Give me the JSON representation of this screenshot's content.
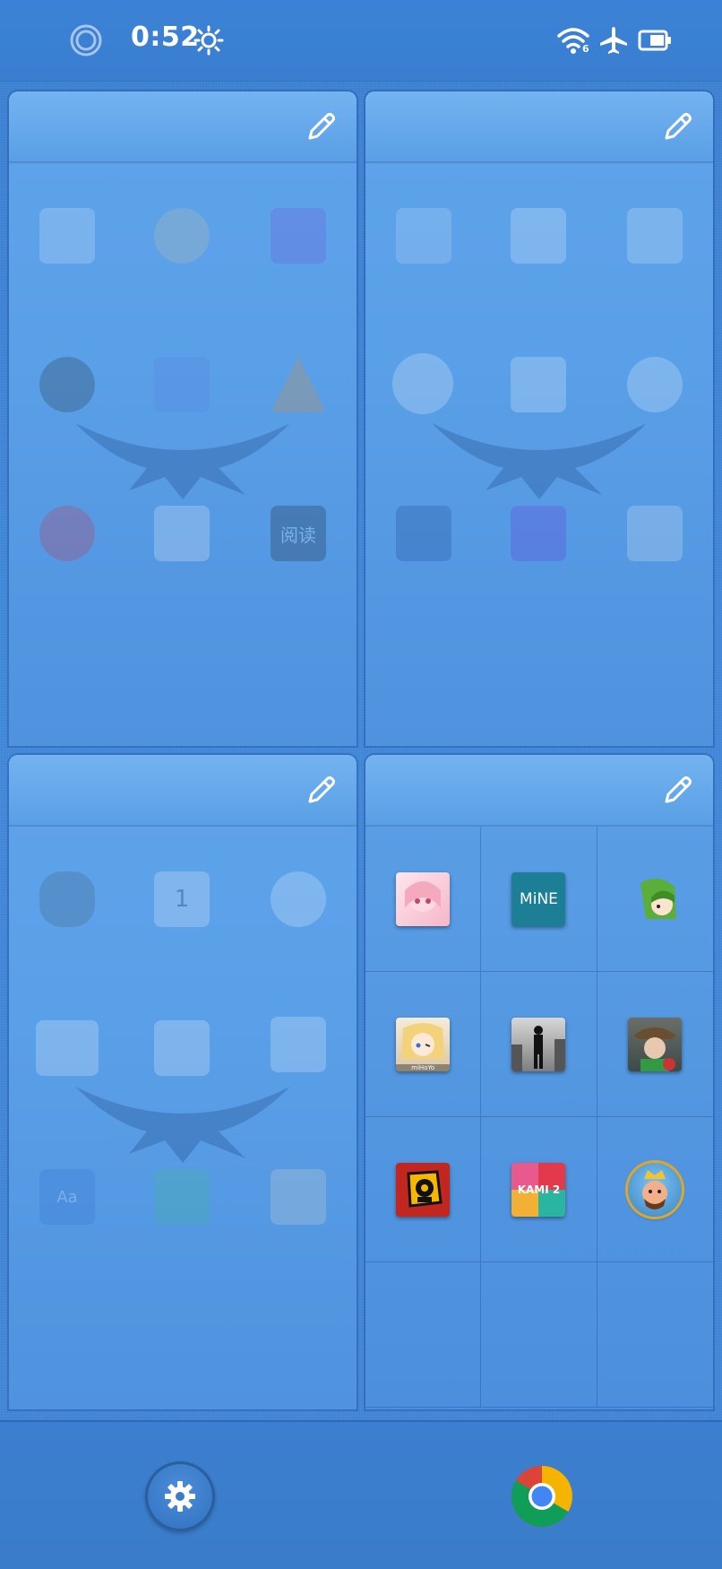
{
  "status_bar": {
    "time": "0:52",
    "wifi_badge": "6",
    "icons": [
      "record-circle-icon",
      "brightness-icon",
      "wifi-icon",
      "airplane-mode-icon",
      "battery-icon"
    ]
  },
  "panels": [
    {
      "name": "panel-1",
      "edit_icon": "pencil-icon"
    },
    {
      "name": "panel-2",
      "edit_icon": "pencil-icon"
    },
    {
      "name": "panel-3",
      "edit_icon": "pencil-icon"
    },
    {
      "name": "panel-4",
      "edit_icon": "pencil-icon"
    }
  ],
  "ghost_labels": {
    "calendar_day": "1",
    "reader_label": "阅读",
    "dict_label": "Aa"
  },
  "folder_apps": [
    {
      "icon": "anime-girl-app-icon",
      "label": ""
    },
    {
      "icon": "mine-app-icon",
      "label": "MiNE"
    },
    {
      "icon": "green-hair-character-app-icon",
      "label": ""
    },
    {
      "icon": "anime-blonde-app-icon",
      "label": "miHoYo"
    },
    {
      "icon": "hitman-game-app-icon",
      "label": ""
    },
    {
      "icon": "identity-v-app-icon",
      "label": ""
    },
    {
      "icon": "brawl-stars-app-icon",
      "label": ""
    },
    {
      "icon": "kami-2-app-icon",
      "label": "KAMI 2"
    },
    {
      "icon": "clash-royale-app-icon",
      "label": ""
    }
  ],
  "dock": {
    "items": [
      "settings-gear-icon",
      "chrome-browser-icon"
    ]
  },
  "colors": {
    "background": "#3f86d8",
    "panel": "#5ea3ea",
    "accent_dark": "#2a5f9e"
  }
}
